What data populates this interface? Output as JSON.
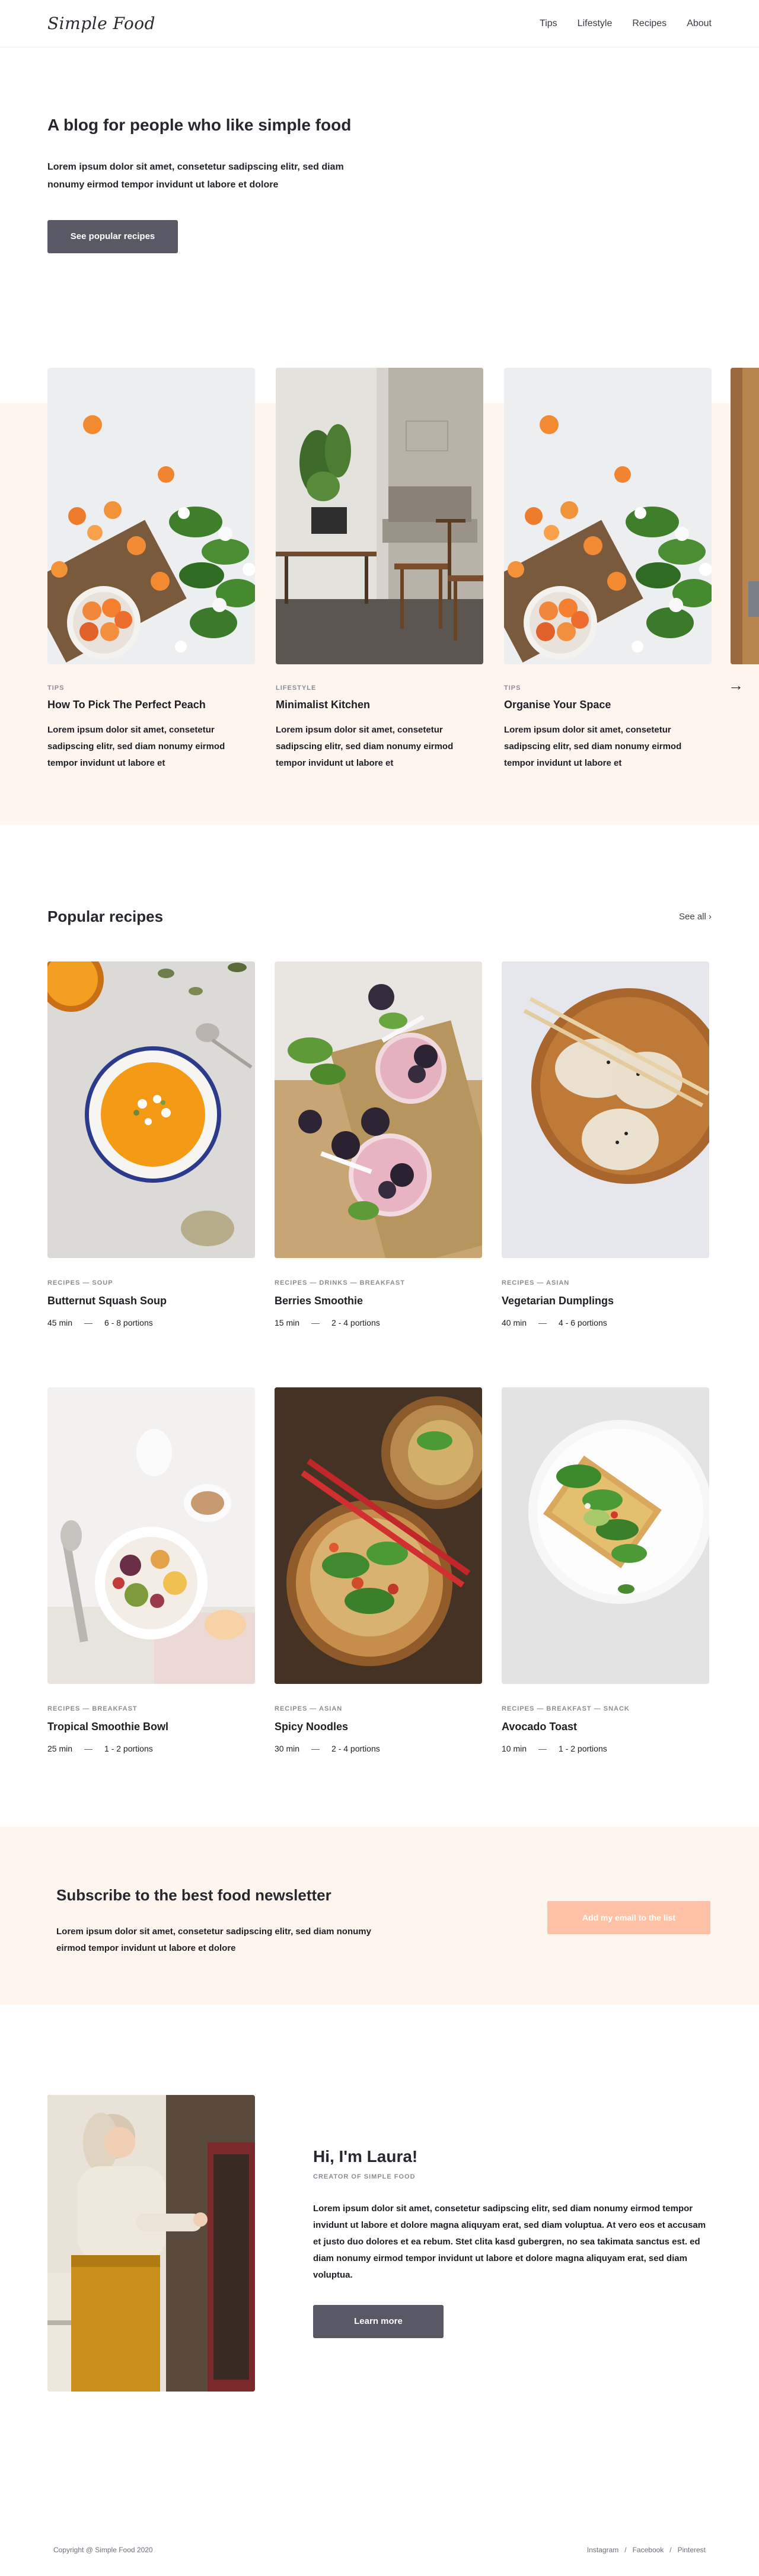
{
  "header": {
    "logo": "Simple Food",
    "nav": [
      "Tips",
      "Lifestyle",
      "Recipes",
      "About"
    ]
  },
  "hero": {
    "title": "A blog for people who like simple food",
    "text": "Lorem ipsum dolor sit amet, consetetur sadipscing elitr, sed diam nonumy eirmod tempor invidunt ut labore et dolore",
    "button": "See popular recipes"
  },
  "carousel": {
    "cards": [
      {
        "category": "TIPS",
        "title": "How To Pick The Perfect Peach",
        "text": "Lorem ipsum dolor sit amet, consetetur sadipscing elitr, sed diam nonumy eirmod tempor invidunt ut labore et"
      },
      {
        "category": "LIFESTYLE",
        "title": "Minimalist Kitchen",
        "text": "Lorem ipsum dolor sit amet, consetetur sadipscing elitr, sed diam nonumy eirmod tempor invidunt ut labore et"
      },
      {
        "category": "TIPS",
        "title": "Organise Your Space",
        "text": "Lorem ipsum dolor sit amet, consetetur sadipscing elitr, sed diam nonumy eirmod tempor invidunt ut labore et"
      }
    ],
    "next_arrow": "→"
  },
  "popular": {
    "title": "Popular recipes",
    "see_all": "See all ›",
    "recipes": [
      {
        "category": "RECIPES — SOUP",
        "title": "Butternut Squash Soup",
        "time": "45 min",
        "sep": "—",
        "portions": "6 - 8 portions"
      },
      {
        "category": "RECIPES — DRINKS — BREAKFAST",
        "title": "Berries Smoothie",
        "time": "15 min",
        "sep": "—",
        "portions": "2 - 4 portions"
      },
      {
        "category": "RECIPES — ASIAN",
        "title": "Vegetarian Dumplings",
        "time": "40 min",
        "sep": "—",
        "portions": "4 - 6 portions"
      },
      {
        "category": "RECIPES — BREAKFAST",
        "title": "Tropical Smoothie Bowl",
        "time": "25 min",
        "sep": "—",
        "portions": "1 - 2 portions"
      },
      {
        "category": "RECIPES — ASIAN",
        "title": "Spicy Noodles",
        "time": "30 min",
        "sep": "—",
        "portions": "2 - 4 portions"
      },
      {
        "category": "RECIPES — BREAKFAST — SNACK",
        "title": "Avocado Toast",
        "time": "10 min",
        "sep": "—",
        "portions": "1 - 2 portions"
      }
    ]
  },
  "newsletter": {
    "title": "Subscribe to the best food newsletter",
    "text": "Lorem ipsum dolor sit amet, consetetur sadipscing elitr, sed diam nonumy eirmod tempor invidunt ut labore et dolore",
    "button": "Add my email to the list"
  },
  "about": {
    "title": "Hi, I'm Laura!",
    "role": "CREATOR OF SIMPLE FOOD",
    "text": "Lorem ipsum dolor sit amet, consetetur sadipscing elitr, sed diam nonumy eirmod tempor invidunt ut labore et dolore magna aliquyam erat, sed diam voluptua. At vero eos et accusam et justo duo dolores et ea rebum. Stet clita kasd gubergren, no sea takimata sanctus est. ed diam nonumy eirmod tempor invidunt ut labore et dolore magna aliquyam erat, sed diam voluptua.",
    "button": "Learn more"
  },
  "footer": {
    "copyright": "Copyright @ Simple Food 2020",
    "links": [
      "Instagram",
      "Facebook",
      "Pinterest"
    ],
    "separator": "/"
  },
  "colors": {
    "accent_peach": "#ffc2a6",
    "peach_bg": "#fff5ef",
    "button_dark": "#595966"
  }
}
